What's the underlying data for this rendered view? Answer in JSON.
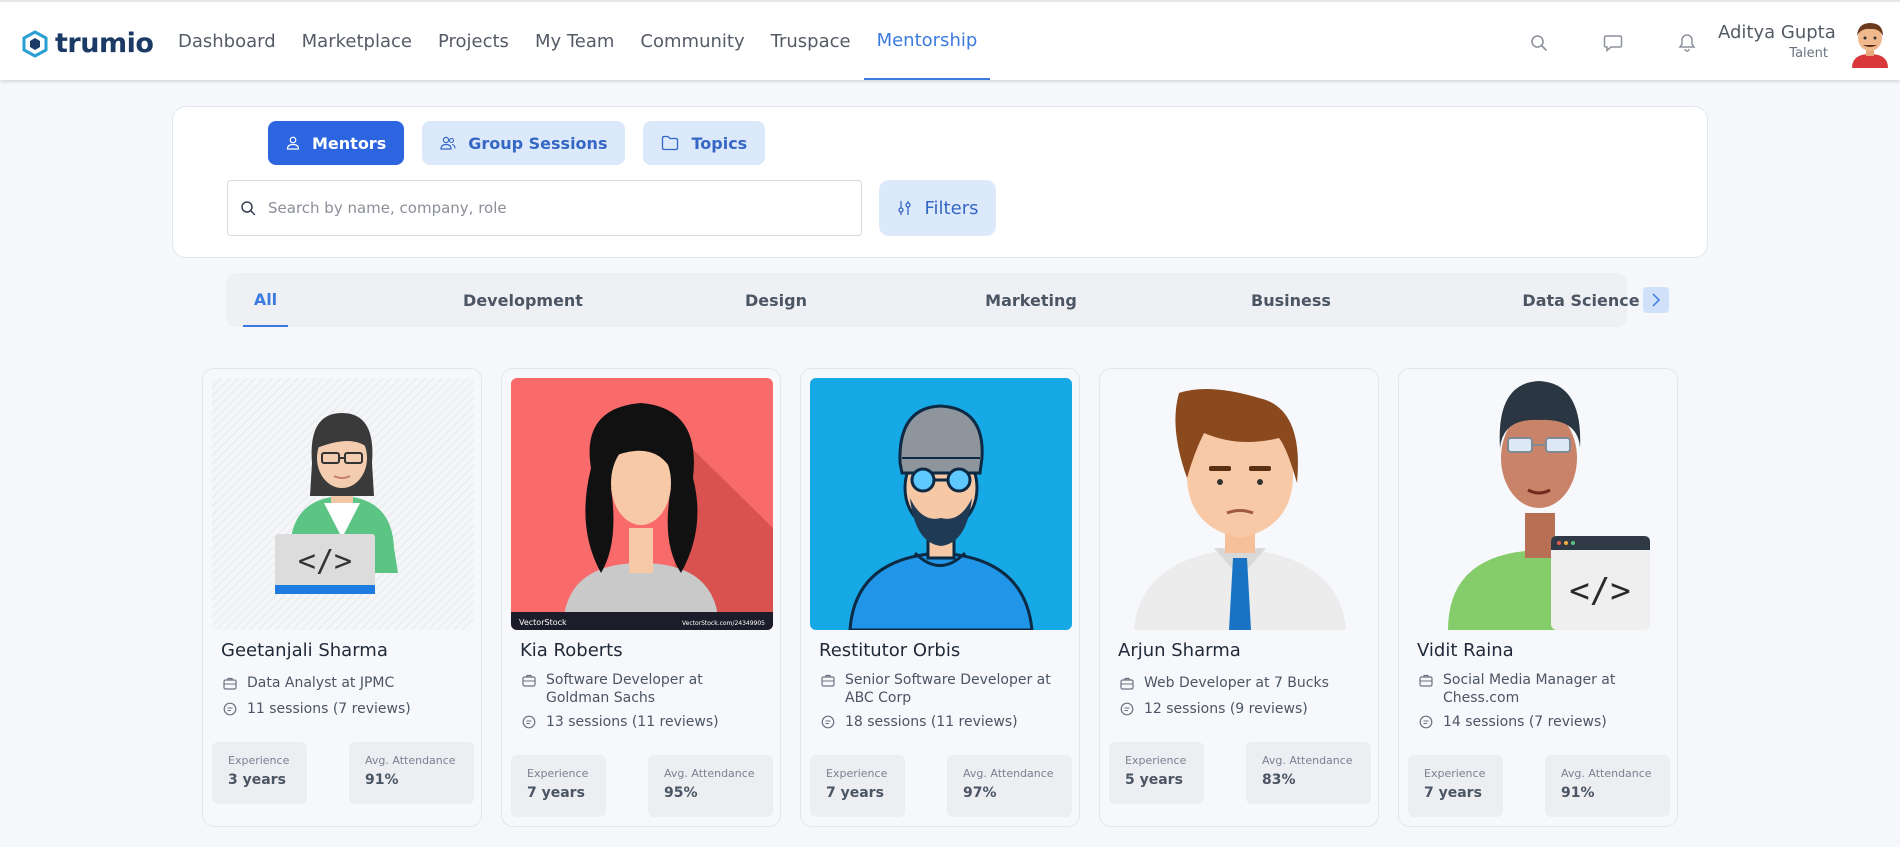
{
  "brand": {
    "name": "trumio"
  },
  "nav": {
    "links": [
      "Dashboard",
      "Marketplace",
      "Projects",
      "My Team",
      "Community",
      "Truspace",
      "Mentorship"
    ],
    "active": "Mentorship"
  },
  "user": {
    "name": "Aditya Gupta",
    "role": "Talent"
  },
  "mode_tabs": [
    {
      "label": "Mentors",
      "icon": "user-icon",
      "active": true
    },
    {
      "label": "Group Sessions",
      "icon": "users-icon",
      "active": false
    },
    {
      "label": "Topics",
      "icon": "folder-icon",
      "active": false
    }
  ],
  "search": {
    "placeholder": "Search by name, company, role",
    "value": ""
  },
  "filters_label": "Filters",
  "categories": [
    "All",
    "Development",
    "Design",
    "Marketing",
    "Business",
    "Data Science"
  ],
  "active_category": "All",
  "mentors": [
    {
      "name": "Geetanjali Sharma",
      "role": "Data Analyst at JPMC",
      "sessions": "11 sessions (7 reviews)",
      "exp_label": "Experience",
      "experience": "3 years",
      "att_label": "Avg. Attendance",
      "attendance": "91%"
    },
    {
      "name": "Kia Roberts",
      "role": "Software Developer at Goldman Sachs",
      "sessions": "13 sessions (11 reviews)",
      "exp_label": "Experience",
      "experience": "7 years",
      "att_label": "Avg. Attendance",
      "attendance": "95%",
      "watermark_left": "VectorStock",
      "watermark_right": "VectorStock.com/24349905"
    },
    {
      "name": "Restitutor Orbis",
      "role": "Senior Software Developer at ABC Corp",
      "sessions": "18 sessions (11 reviews)",
      "exp_label": "Experience",
      "experience": "7 years",
      "att_label": "Avg. Attendance",
      "attendance": "97%"
    },
    {
      "name": "Arjun Sharma",
      "role": "Web Developer at 7 Bucks",
      "sessions": "12 sessions (9 reviews)",
      "exp_label": "Experience",
      "experience": "5 years",
      "att_label": "Avg. Attendance",
      "attendance": "83%"
    },
    {
      "name": "Vidit Raina",
      "role": "Social Media Manager at Chess.com",
      "sessions": "14 sessions (7 reviews)",
      "exp_label": "Experience",
      "experience": "7 years",
      "att_label": "Avg. Attendance",
      "attendance": "91%"
    }
  ],
  "colors": {
    "primary": "#2d65e0",
    "accent": "#3b7be0",
    "tab_bg": "#dce9fb",
    "brand_dark": "#1b3a66"
  }
}
